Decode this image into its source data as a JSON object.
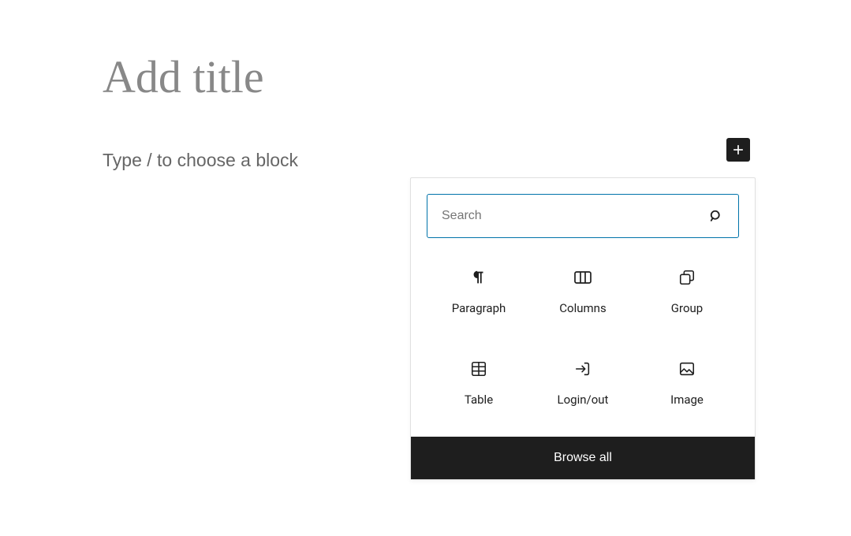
{
  "editor": {
    "title_placeholder": "Add title",
    "content_placeholder": "Type / to choose a block"
  },
  "inserter": {
    "search_placeholder": "Search",
    "blocks": [
      {
        "name": "paragraph",
        "label": "Paragraph"
      },
      {
        "name": "columns",
        "label": "Columns"
      },
      {
        "name": "group",
        "label": "Group"
      },
      {
        "name": "table",
        "label": "Table"
      },
      {
        "name": "login-out",
        "label": "Login/out"
      },
      {
        "name": "image",
        "label": "Image"
      }
    ],
    "browse_all_label": "Browse all"
  }
}
